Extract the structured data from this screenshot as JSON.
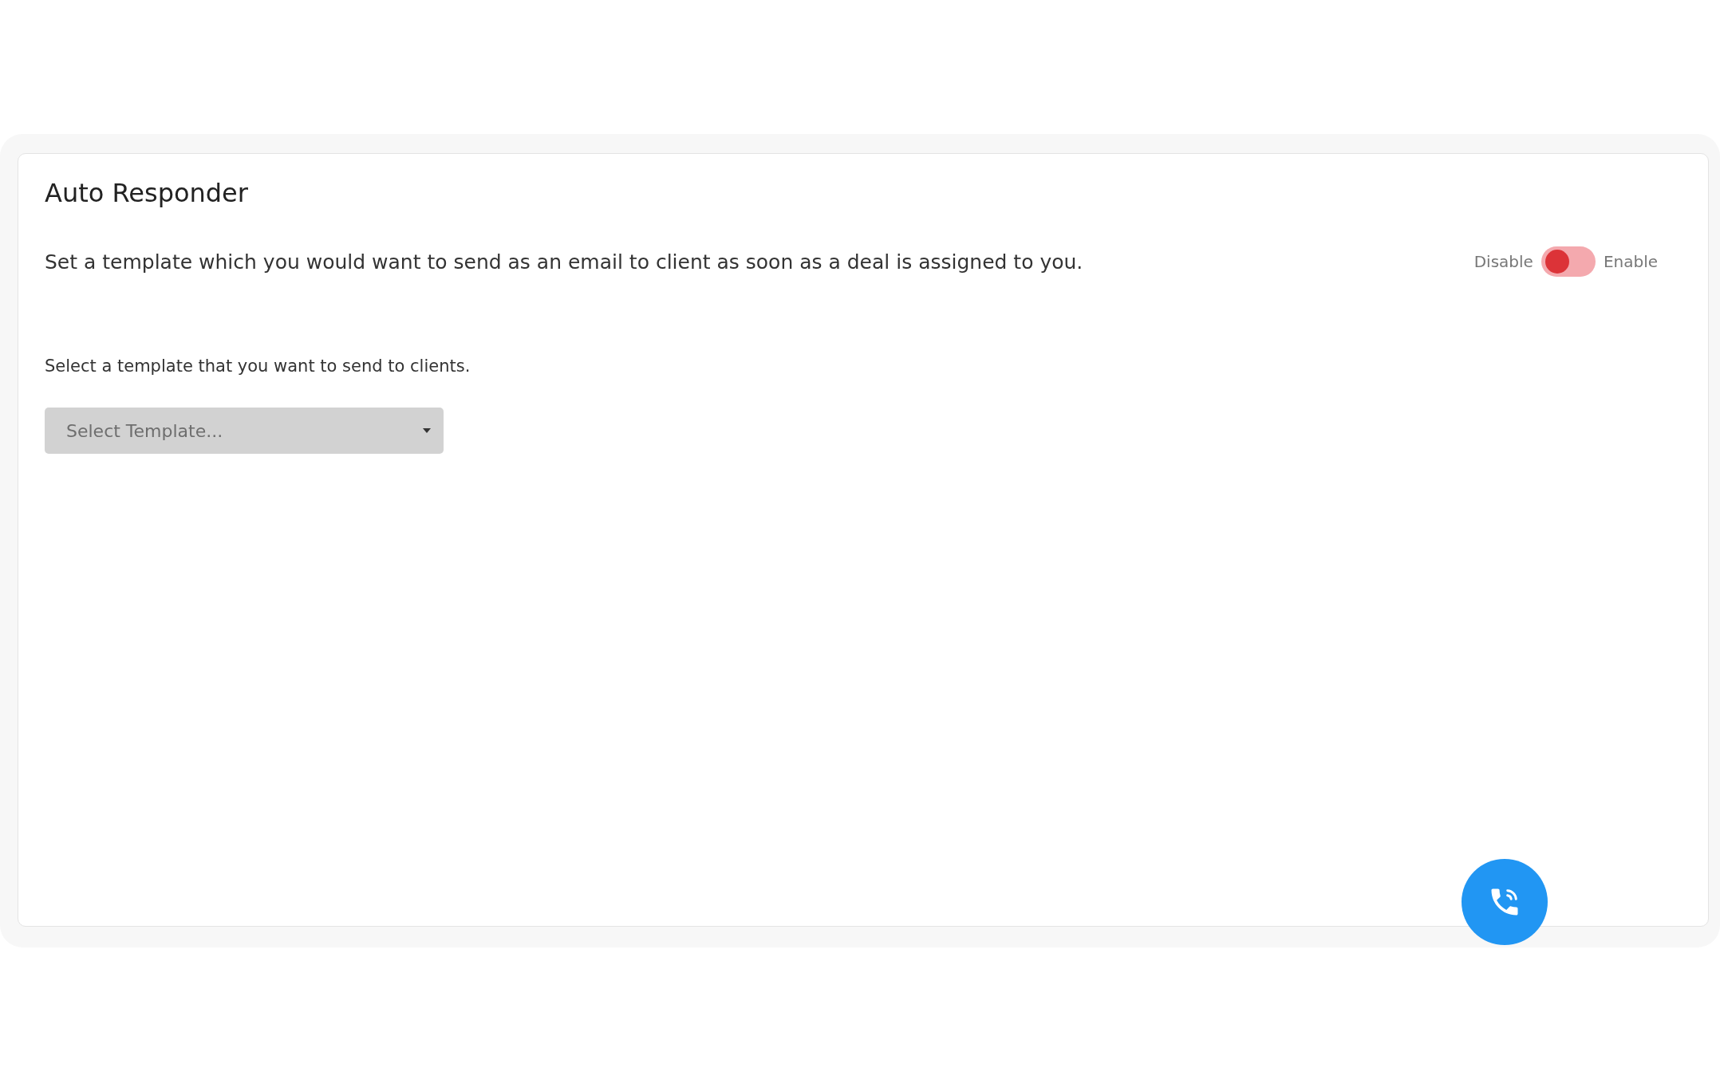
{
  "card": {
    "title": "Auto Responder",
    "description": "Set a template which you would want to send as an email to client as soon as a deal is assigned to you.",
    "toggle": {
      "off_label": "Disable",
      "on_label": "Enable",
      "on": false
    },
    "select_label": "Select a template that you want to send to clients.",
    "template_select": {
      "placeholder": "Select Template..."
    }
  }
}
